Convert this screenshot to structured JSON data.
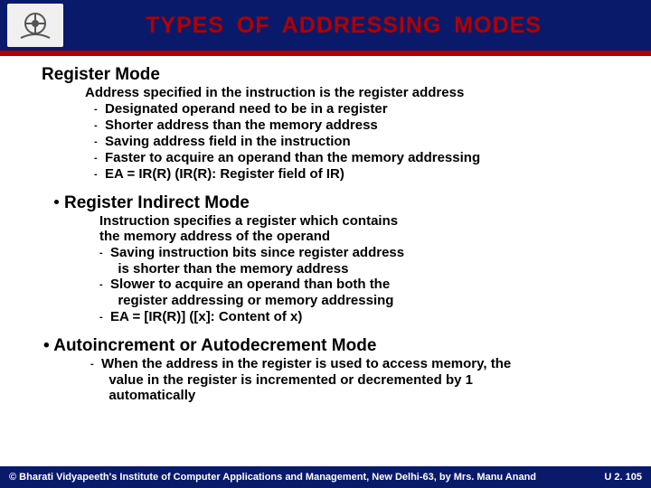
{
  "slide": {
    "title": "TYPES  OF  ADDRESSING  MODES",
    "sections": [
      {
        "heading": "Register Mode",
        "heading_prefix": "",
        "desc": "Address specified in the instruction is the register address",
        "bullets": [
          "Designated operand need to be in a register",
          "Shorter address than the memory address",
          "Saving address field in the instruction",
          "Faster to acquire an operand than the memory addressing",
          "EA = IR(R)  (IR(R): Register field of IR)"
        ]
      },
      {
        "heading": "Register Indirect Mode",
        "heading_prefix": "bullet",
        "desc": "Instruction specifies a register which contains\nthe memory address of the operand",
        "bullets": [
          "Saving instruction bits since register address\n  is shorter than the memory address",
          "Slower to acquire an operand than both the\n  register addressing or memory addressing",
          "EA = [IR(R)] ([x]: Content of x)"
        ]
      },
      {
        "heading": "Autoincrement or Autodecrement Mode",
        "heading_prefix": "bullet-text",
        "desc": "",
        "bullets": [
          "When the address in the register is used to access memory, the\n  value in the register is incremented or decremented by 1\n  automatically"
        ]
      }
    ],
    "footer": {
      "copyright": "© Bharati Vidyapeeth's Institute of Computer Applications and Management, New Delhi-63, by Mrs. Manu Anand",
      "page": "U 2. 105"
    }
  }
}
